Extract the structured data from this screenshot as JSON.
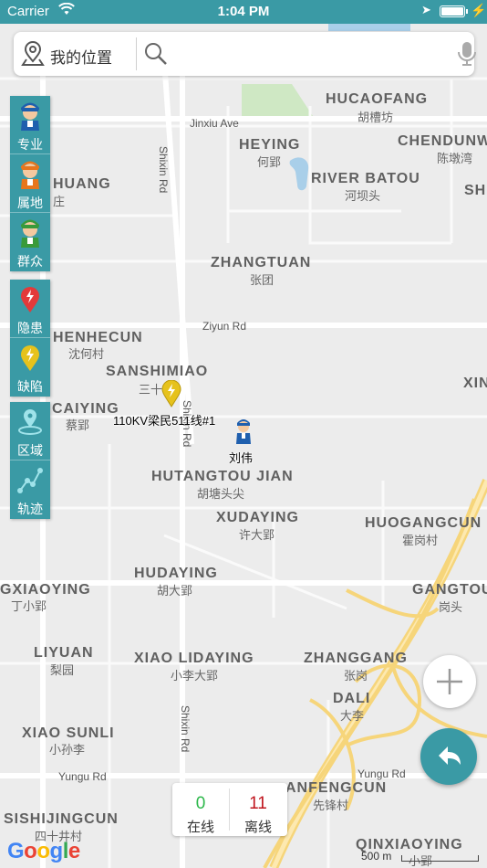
{
  "status_bar": {
    "carrier": "Carrier",
    "time": "1:04 PM"
  },
  "search": {
    "my_location_label": "我的位置",
    "placeholder": ""
  },
  "side_panel": {
    "group1": [
      {
        "label": "专业",
        "icon": "worker-blue-icon"
      },
      {
        "label": "属地",
        "icon": "worker-orange-icon"
      },
      {
        "label": "群众",
        "icon": "worker-green-icon"
      }
    ],
    "group2": [
      {
        "label": "隐患",
        "icon": "red-pin-icon"
      },
      {
        "label": "缺陷",
        "icon": "yellow-pin-icon"
      }
    ],
    "group3": [
      {
        "label": "区域",
        "icon": "area-icon"
      },
      {
        "label": "轨迹",
        "icon": "track-icon"
      }
    ]
  },
  "map": {
    "areas": [
      {
        "en": "HUCAOFANG",
        "cn": "胡槽坊"
      },
      {
        "en": "HEYING",
        "cn": "何郢"
      },
      {
        "en": "CHENDUNW",
        "cn": "陈墩湾"
      },
      {
        "en": "RIVER BATOU",
        "cn": "河坝头"
      },
      {
        "en": "HUANG",
        "cn": "庄"
      },
      {
        "en": "SH",
        "cn": ""
      },
      {
        "en": "ZHANGTUAN",
        "cn": "张团"
      },
      {
        "en": "HENHECUN",
        "cn": "沈何村"
      },
      {
        "en": "SANSHIMIAO",
        "cn": "三十"
      },
      {
        "en": "XIN",
        "cn": ""
      },
      {
        "en": "CAIYING",
        "cn": "蔡郢"
      },
      {
        "en": "HUTANGTOU JIAN",
        "cn": "胡塘头尖"
      },
      {
        "en": "XUDAYING",
        "cn": "许大郢"
      },
      {
        "en": "HUOGANGCUN",
        "cn": "霍岗村"
      },
      {
        "en": "HUDAYING",
        "cn": "胡大郢"
      },
      {
        "en": "GXIAOYING",
        "cn": "丁小郢"
      },
      {
        "en": "GANGTOU",
        "cn": "岗头"
      },
      {
        "en": "LIYUAN",
        "cn": "梨园"
      },
      {
        "en": "XIAO LIDAYING",
        "cn": "小李大郢"
      },
      {
        "en": "ZHANGGANG",
        "cn": "张岗"
      },
      {
        "en": "DALI",
        "cn": "大李"
      },
      {
        "en": "XIAO SUNLI",
        "cn": "小孙李"
      },
      {
        "en": "ANFENGCUN",
        "cn": "先锋村"
      },
      {
        "en": "SISHIJINGCUN",
        "cn": "四十井村"
      },
      {
        "en": "QINXIAOYING",
        "cn": "小郢"
      }
    ],
    "roads": {
      "jinxiu": "Jinxiu Ave",
      "shixin1": "Shixin Rd",
      "ziyun": "Ziyun Rd",
      "shixin2": "Shixin Rd",
      "shixin3": "Shixin Rd",
      "yungu1": "Yungu Rd",
      "yungu2": "Yungu Rd"
    },
    "defect_marker_label": "110KV梁民511线#1",
    "person_marker_label": "刘伟"
  },
  "stats": {
    "online_count": "0",
    "online_label": "在线",
    "offline_count": "11",
    "offline_label": "离线"
  },
  "attribution": {
    "logo": "Google",
    "scale": "500 m"
  },
  "colors": {
    "teal": "#3a9aa5",
    "online": "#2db84b",
    "offline": "#c0151e"
  }
}
